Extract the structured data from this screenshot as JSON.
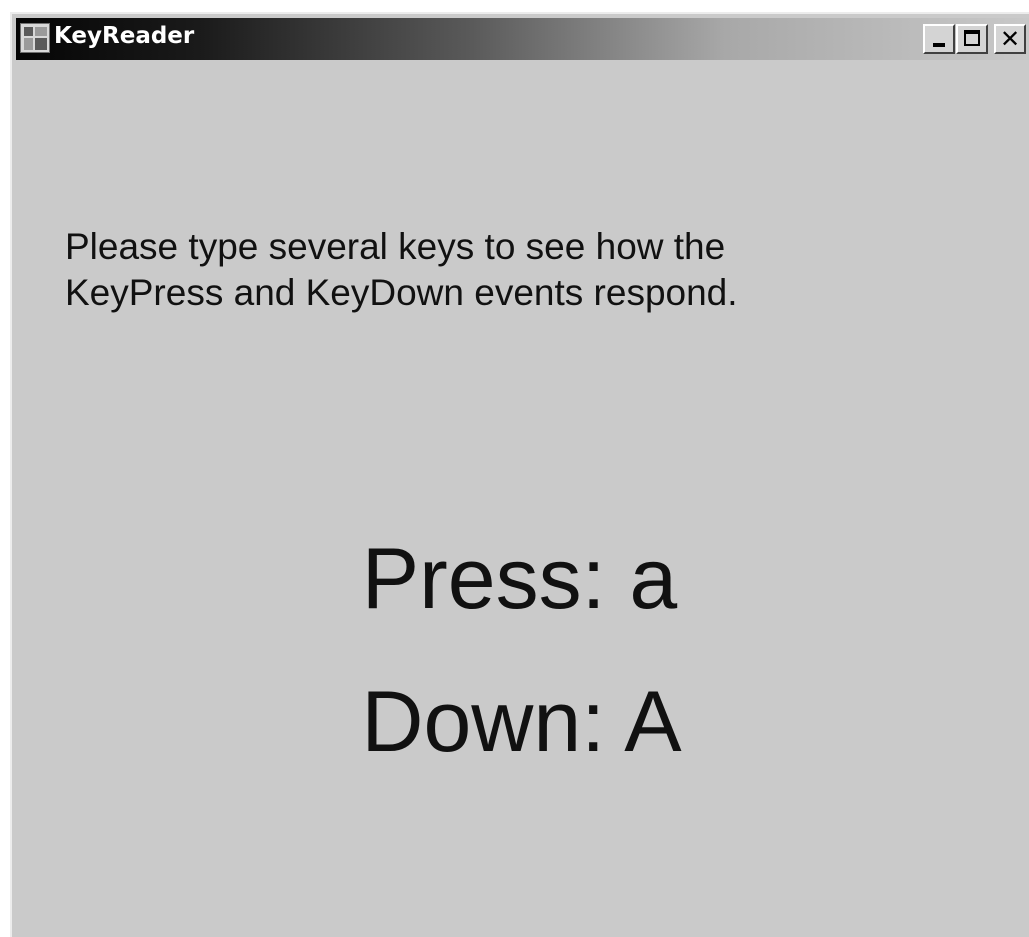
{
  "window": {
    "title": "KeyReader",
    "controls": {
      "minimize_icon": "minimize-icon",
      "maximize_icon": "maximize-icon",
      "close_glyph": "✕"
    }
  },
  "content": {
    "instructions": [
      "Please type several keys to see how the",
      "KeyPress and KeyDown events respond."
    ],
    "press_label": "Press: a",
    "down_label": "Down: A"
  },
  "colors": {
    "form_background": "#cacaca",
    "text": "#111111",
    "titlebar_start": "#050505",
    "titlebar_end": "#c8c8c8"
  }
}
